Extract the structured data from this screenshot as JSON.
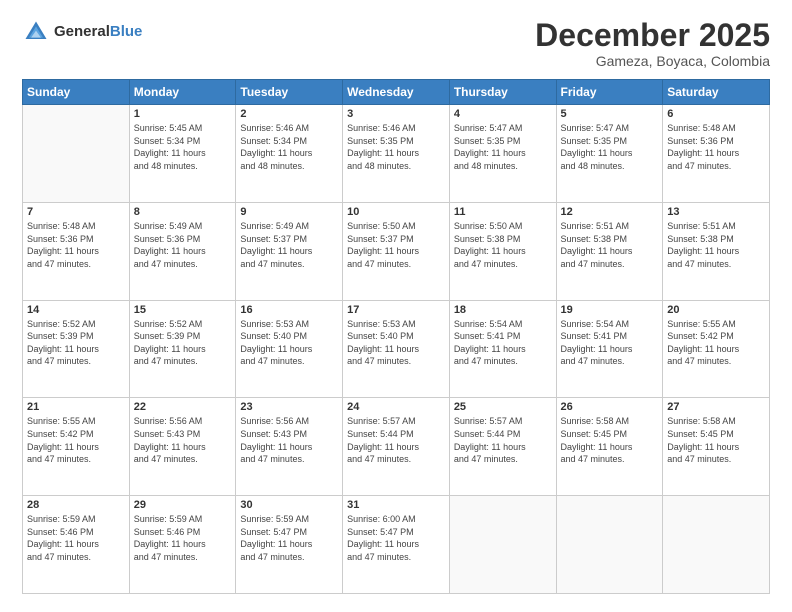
{
  "header": {
    "logo_general": "General",
    "logo_blue": "Blue",
    "month_title": "December 2025",
    "location": "Gameza, Boyaca, Colombia"
  },
  "days_of_week": [
    "Sunday",
    "Monday",
    "Tuesday",
    "Wednesday",
    "Thursday",
    "Friday",
    "Saturday"
  ],
  "weeks": [
    [
      {
        "day": "",
        "text": ""
      },
      {
        "day": "1",
        "text": "Sunrise: 5:45 AM\nSunset: 5:34 PM\nDaylight: 11 hours\nand 48 minutes."
      },
      {
        "day": "2",
        "text": "Sunrise: 5:46 AM\nSunset: 5:34 PM\nDaylight: 11 hours\nand 48 minutes."
      },
      {
        "day": "3",
        "text": "Sunrise: 5:46 AM\nSunset: 5:35 PM\nDaylight: 11 hours\nand 48 minutes."
      },
      {
        "day": "4",
        "text": "Sunrise: 5:47 AM\nSunset: 5:35 PM\nDaylight: 11 hours\nand 48 minutes."
      },
      {
        "day": "5",
        "text": "Sunrise: 5:47 AM\nSunset: 5:35 PM\nDaylight: 11 hours\nand 48 minutes."
      },
      {
        "day": "6",
        "text": "Sunrise: 5:48 AM\nSunset: 5:36 PM\nDaylight: 11 hours\nand 47 minutes."
      }
    ],
    [
      {
        "day": "7",
        "text": "Sunrise: 5:48 AM\nSunset: 5:36 PM\nDaylight: 11 hours\nand 47 minutes."
      },
      {
        "day": "8",
        "text": "Sunrise: 5:49 AM\nSunset: 5:36 PM\nDaylight: 11 hours\nand 47 minutes."
      },
      {
        "day": "9",
        "text": "Sunrise: 5:49 AM\nSunset: 5:37 PM\nDaylight: 11 hours\nand 47 minutes."
      },
      {
        "day": "10",
        "text": "Sunrise: 5:50 AM\nSunset: 5:37 PM\nDaylight: 11 hours\nand 47 minutes."
      },
      {
        "day": "11",
        "text": "Sunrise: 5:50 AM\nSunset: 5:38 PM\nDaylight: 11 hours\nand 47 minutes."
      },
      {
        "day": "12",
        "text": "Sunrise: 5:51 AM\nSunset: 5:38 PM\nDaylight: 11 hours\nand 47 minutes."
      },
      {
        "day": "13",
        "text": "Sunrise: 5:51 AM\nSunset: 5:38 PM\nDaylight: 11 hours\nand 47 minutes."
      }
    ],
    [
      {
        "day": "14",
        "text": "Sunrise: 5:52 AM\nSunset: 5:39 PM\nDaylight: 11 hours\nand 47 minutes."
      },
      {
        "day": "15",
        "text": "Sunrise: 5:52 AM\nSunset: 5:39 PM\nDaylight: 11 hours\nand 47 minutes."
      },
      {
        "day": "16",
        "text": "Sunrise: 5:53 AM\nSunset: 5:40 PM\nDaylight: 11 hours\nand 47 minutes."
      },
      {
        "day": "17",
        "text": "Sunrise: 5:53 AM\nSunset: 5:40 PM\nDaylight: 11 hours\nand 47 minutes."
      },
      {
        "day": "18",
        "text": "Sunrise: 5:54 AM\nSunset: 5:41 PM\nDaylight: 11 hours\nand 47 minutes."
      },
      {
        "day": "19",
        "text": "Sunrise: 5:54 AM\nSunset: 5:41 PM\nDaylight: 11 hours\nand 47 minutes."
      },
      {
        "day": "20",
        "text": "Sunrise: 5:55 AM\nSunset: 5:42 PM\nDaylight: 11 hours\nand 47 minutes."
      }
    ],
    [
      {
        "day": "21",
        "text": "Sunrise: 5:55 AM\nSunset: 5:42 PM\nDaylight: 11 hours\nand 47 minutes."
      },
      {
        "day": "22",
        "text": "Sunrise: 5:56 AM\nSunset: 5:43 PM\nDaylight: 11 hours\nand 47 minutes."
      },
      {
        "day": "23",
        "text": "Sunrise: 5:56 AM\nSunset: 5:43 PM\nDaylight: 11 hours\nand 47 minutes."
      },
      {
        "day": "24",
        "text": "Sunrise: 5:57 AM\nSunset: 5:44 PM\nDaylight: 11 hours\nand 47 minutes."
      },
      {
        "day": "25",
        "text": "Sunrise: 5:57 AM\nSunset: 5:44 PM\nDaylight: 11 hours\nand 47 minutes."
      },
      {
        "day": "26",
        "text": "Sunrise: 5:58 AM\nSunset: 5:45 PM\nDaylight: 11 hours\nand 47 minutes."
      },
      {
        "day": "27",
        "text": "Sunrise: 5:58 AM\nSunset: 5:45 PM\nDaylight: 11 hours\nand 47 minutes."
      }
    ],
    [
      {
        "day": "28",
        "text": "Sunrise: 5:59 AM\nSunset: 5:46 PM\nDaylight: 11 hours\nand 47 minutes."
      },
      {
        "day": "29",
        "text": "Sunrise: 5:59 AM\nSunset: 5:46 PM\nDaylight: 11 hours\nand 47 minutes."
      },
      {
        "day": "30",
        "text": "Sunrise: 5:59 AM\nSunset: 5:47 PM\nDaylight: 11 hours\nand 47 minutes."
      },
      {
        "day": "31",
        "text": "Sunrise: 6:00 AM\nSunset: 5:47 PM\nDaylight: 11 hours\nand 47 minutes."
      },
      {
        "day": "",
        "text": ""
      },
      {
        "day": "",
        "text": ""
      },
      {
        "day": "",
        "text": ""
      }
    ]
  ]
}
